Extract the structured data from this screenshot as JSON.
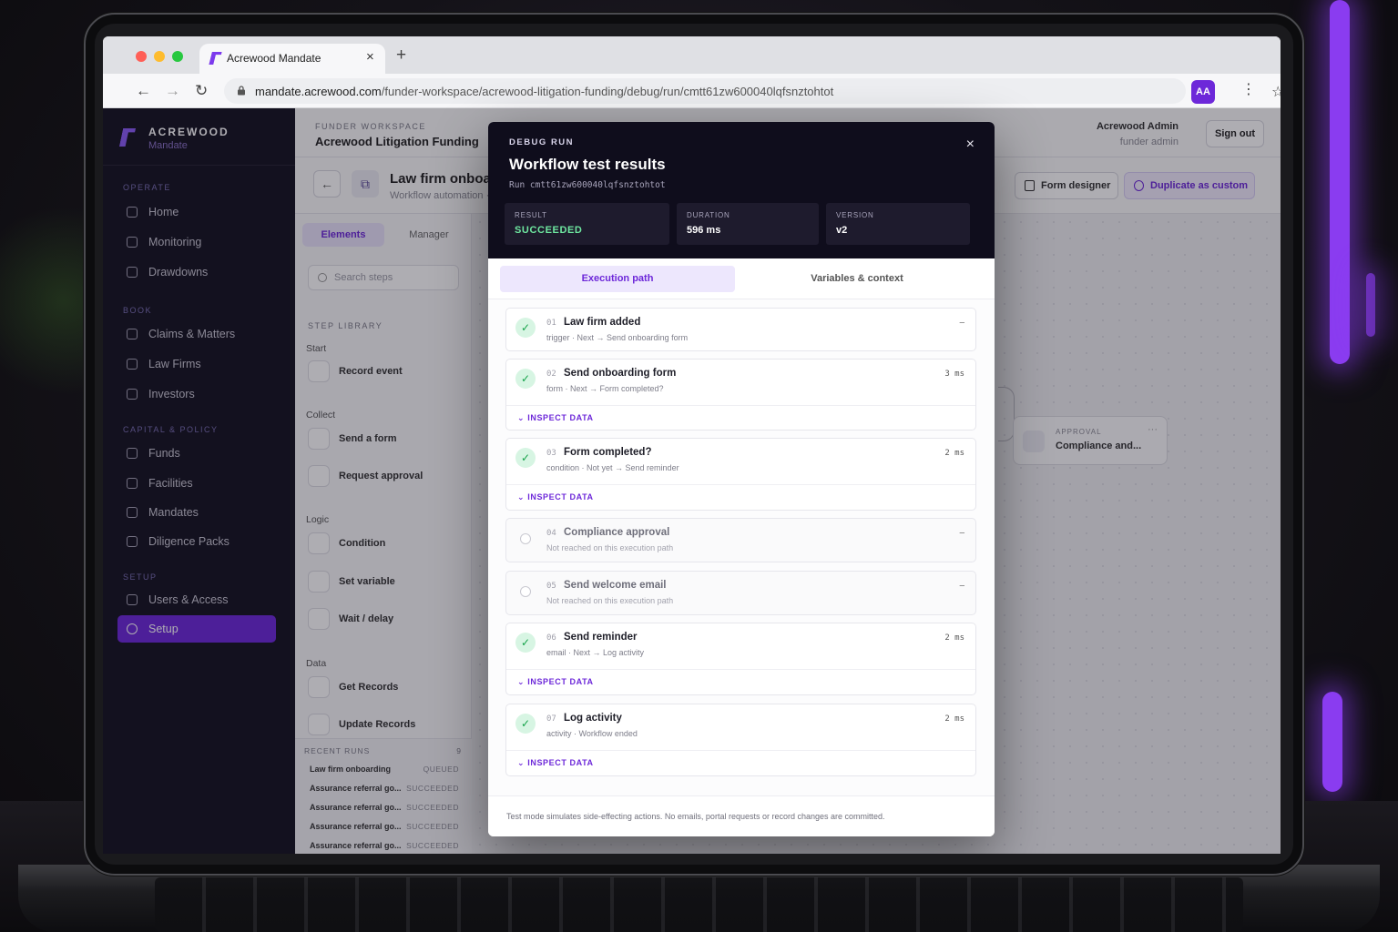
{
  "browser": {
    "tab_title": "Acrewood Mandate",
    "tab_close": "×",
    "new_tab": "+",
    "url_host": "mandate.acrewood.com",
    "url_path": "/funder-workspace/acrewood-litigation-funding/debug/run/cmtt61zw600040lqfsnztohtot",
    "avatar_initials": "AA",
    "nav": {
      "back": "←",
      "forward": "→",
      "reload": "↻",
      "star": "☆",
      "menu": "⋮"
    }
  },
  "sidebar": {
    "brand_name": "ACREWOOD",
    "brand_sub": "Mandate",
    "sections": [
      {
        "title": "OPERATE",
        "items": [
          "Home",
          "Monitoring",
          "Drawdowns"
        ]
      },
      {
        "title": "BOOK",
        "items": [
          "Claims & Matters",
          "Law Firms",
          "Investors"
        ]
      },
      {
        "title": "CAPITAL & POLICY",
        "items": [
          "Funds",
          "Facilities",
          "Mandates",
          "Diligence Packs"
        ]
      },
      {
        "title": "SETUP",
        "items": [
          "Users & Access",
          "Setup"
        ]
      }
    ],
    "active_item": "Setup"
  },
  "topbar": {
    "workspace_label": "FUNDER WORKSPACE",
    "workspace_name": "Acrewood Litigation Funding",
    "user_name": "Acrewood Admin",
    "user_role": "funder admin",
    "sign_out": "Sign out"
  },
  "subbar": {
    "back": "←",
    "workflow_title": "Law firm onboarding",
    "workflow_sub": "Workflow automation · v2",
    "form_designer": "Form designer",
    "duplicate": "Duplicate as custom"
  },
  "leftpanel": {
    "tab_elements": "Elements",
    "tab_manager": "Manager",
    "search_placeholder": "Search steps",
    "library_title": "STEP LIBRARY",
    "groups": [
      {
        "name": "Start",
        "items": [
          "Record event"
        ]
      },
      {
        "name": "Collect",
        "items": [
          "Send a form",
          "Request approval"
        ]
      },
      {
        "name": "Logic",
        "items": [
          "Condition",
          "Set variable",
          "Wait / delay"
        ]
      },
      {
        "name": "Data",
        "items": [
          "Get Records",
          "Update Records"
        ]
      }
    ],
    "recent_runs_title": "RECENT RUNS",
    "recent_runs_count": "9",
    "recent_runs": [
      {
        "name": "Law firm onboarding",
        "status": "QUEUED"
      },
      {
        "name": "Assurance referral go...",
        "status": "SUCCEEDED"
      },
      {
        "name": "Assurance referral go...",
        "status": "SUCCEEDED"
      },
      {
        "name": "Assurance referral go...",
        "status": "SUCCEEDED"
      },
      {
        "name": "Assurance referral go...",
        "status": "SUCCEEDED"
      }
    ]
  },
  "canvas": {
    "node_label": "APPROVAL",
    "node_title": "Compliance and...",
    "node_menu": "···"
  },
  "modal": {
    "eyebrow": "DEBUG RUN",
    "title": "Workflow test results",
    "run_id": "Run cmtt61zw600040lqfsnztohtot",
    "close": "×",
    "stats": [
      {
        "label": "RESULT",
        "value": "SUCCEEDED"
      },
      {
        "label": "DURATION",
        "value": "596 ms"
      },
      {
        "label": "VERSION",
        "value": "v2"
      }
    ],
    "tab_execution": "Execution path",
    "tab_variables": "Variables & context",
    "inspect_label": "INSPECT DATA",
    "steps": [
      {
        "num": "01",
        "title": "Law firm added",
        "sub": "trigger · Next → Send onboarding form",
        "duration": "–",
        "status": "done",
        "inspect": false
      },
      {
        "num": "02",
        "title": "Send onboarding form",
        "sub": "form · Next → Form completed?",
        "duration": "3 ms",
        "status": "done",
        "inspect": true
      },
      {
        "num": "03",
        "title": "Form completed?",
        "sub": "condition · Not yet → Send reminder",
        "duration": "2 ms",
        "status": "done",
        "inspect": true
      },
      {
        "num": "04",
        "title": "Compliance approval",
        "sub": "Not reached on this execution path",
        "duration": "–",
        "status": "not_reached",
        "inspect": false
      },
      {
        "num": "05",
        "title": "Send welcome email",
        "sub": "Not reached on this execution path",
        "duration": "–",
        "status": "not_reached",
        "inspect": false
      },
      {
        "num": "06",
        "title": "Send reminder",
        "sub": "email · Next → Log activity",
        "duration": "2 ms",
        "status": "done",
        "inspect": true
      },
      {
        "num": "07",
        "title": "Log activity",
        "sub": "activity · Workflow ended",
        "duration": "2 ms",
        "status": "done",
        "inspect": true
      }
    ],
    "footer": "Test mode simulates side-effecting actions. No emails, portal requests or record changes are committed."
  },
  "colors": {
    "accent": "#6d28d9",
    "success": "#6ee7a0",
    "sidebar_bg": "#151321",
    "modal_header": "#0f0d1c"
  }
}
